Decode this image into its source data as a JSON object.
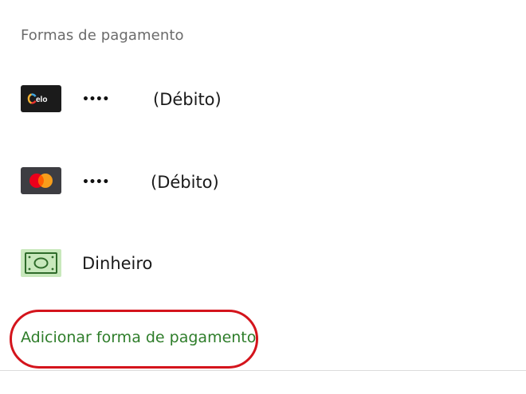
{
  "section": {
    "title": "Formas de pagamento"
  },
  "payment_methods": [
    {
      "icon": "elo-card-icon",
      "masked_number": "••••",
      "type": "(Débito)",
      "brand_text": "elo"
    },
    {
      "icon": "mastercard-icon",
      "masked_number": "••••",
      "type": "(Débito)"
    },
    {
      "icon": "cash-icon",
      "label": "Dinheiro"
    }
  ],
  "actions": {
    "add_payment_label": "Adicionar forma de pagamento"
  },
  "colors": {
    "link_green": "#2e7d2a",
    "highlight_red": "#d4141c",
    "muted_text": "#6b6b6b"
  }
}
